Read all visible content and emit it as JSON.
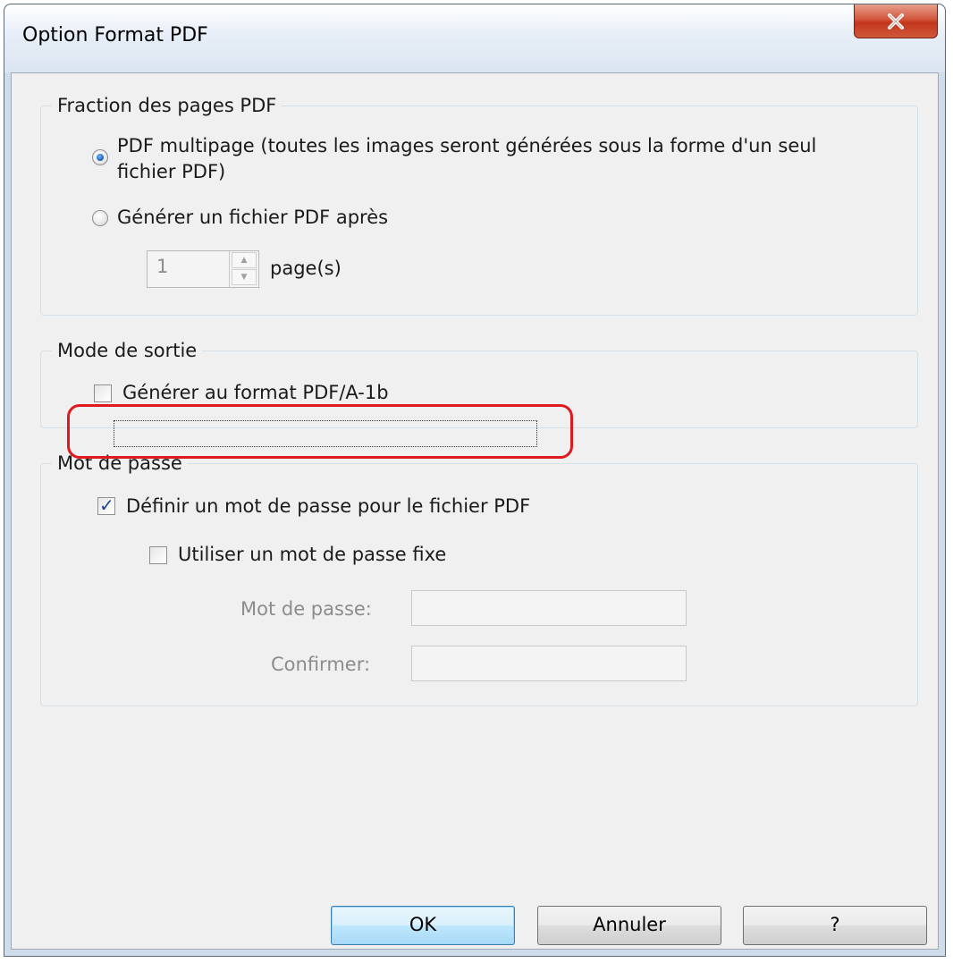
{
  "window": {
    "title": "Option Format PDF",
    "close_label": "x"
  },
  "split_group": {
    "legend": "Fraction des pages PDF",
    "option_multipage": "PDF multipage (toutes les images seront générées sous la forme d'un seul",
    "option_multipage_line2": "fichier PDF)",
    "option_multipage_selected": true,
    "option_split": "Générer un fichier PDF après",
    "option_split_selected": false,
    "pages_value": "1",
    "pages_unit": "page(s)"
  },
  "output_group": {
    "legend": "Mode de sortie",
    "pdfa_label": "Générer au format PDF/A-1b",
    "pdfa_checked": false
  },
  "password_group": {
    "legend": "Mot de passe",
    "set_password_label": "Définir un mot de passe pour le fichier PDF",
    "set_password_checked": true,
    "fixed_password_label": "Utiliser un mot de passe fixe",
    "fixed_password_checked": false,
    "password_label": "Mot de passe:",
    "password_value": "",
    "confirm_label": "Confirmer:",
    "confirm_value": ""
  },
  "buttons": {
    "ok": "OK",
    "cancel": "Annuler",
    "help": "?"
  },
  "colors": {
    "highlight": "#e0191f",
    "close_button": "#c2361b",
    "default_button_border": "#3c7fb1"
  }
}
